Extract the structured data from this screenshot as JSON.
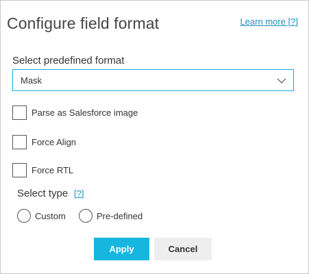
{
  "dialog": {
    "title": "Configure field format",
    "learn_more": "Learn more [?]"
  },
  "format": {
    "label": "Select predefined format",
    "selected": "Mask",
    "icon": "chevron-down-icon"
  },
  "options": {
    "parse_salesforce_image": {
      "label": "Parse as Salesforce image",
      "checked": false
    },
    "force_align": {
      "label": "Force Align",
      "checked": false
    },
    "force_rtl": {
      "label": "Force RTL",
      "checked": false
    }
  },
  "type": {
    "label": "Select type",
    "help": "[?]",
    "radios": [
      {
        "label": "Custom",
        "selected": false
      },
      {
        "label": "Pre-defined",
        "selected": false
      }
    ]
  },
  "buttons": {
    "apply": "Apply",
    "cancel": "Cancel"
  },
  "colors": {
    "accent": "#17b6e0",
    "link": "#1a8fb8",
    "border": "#c8c8c8"
  }
}
